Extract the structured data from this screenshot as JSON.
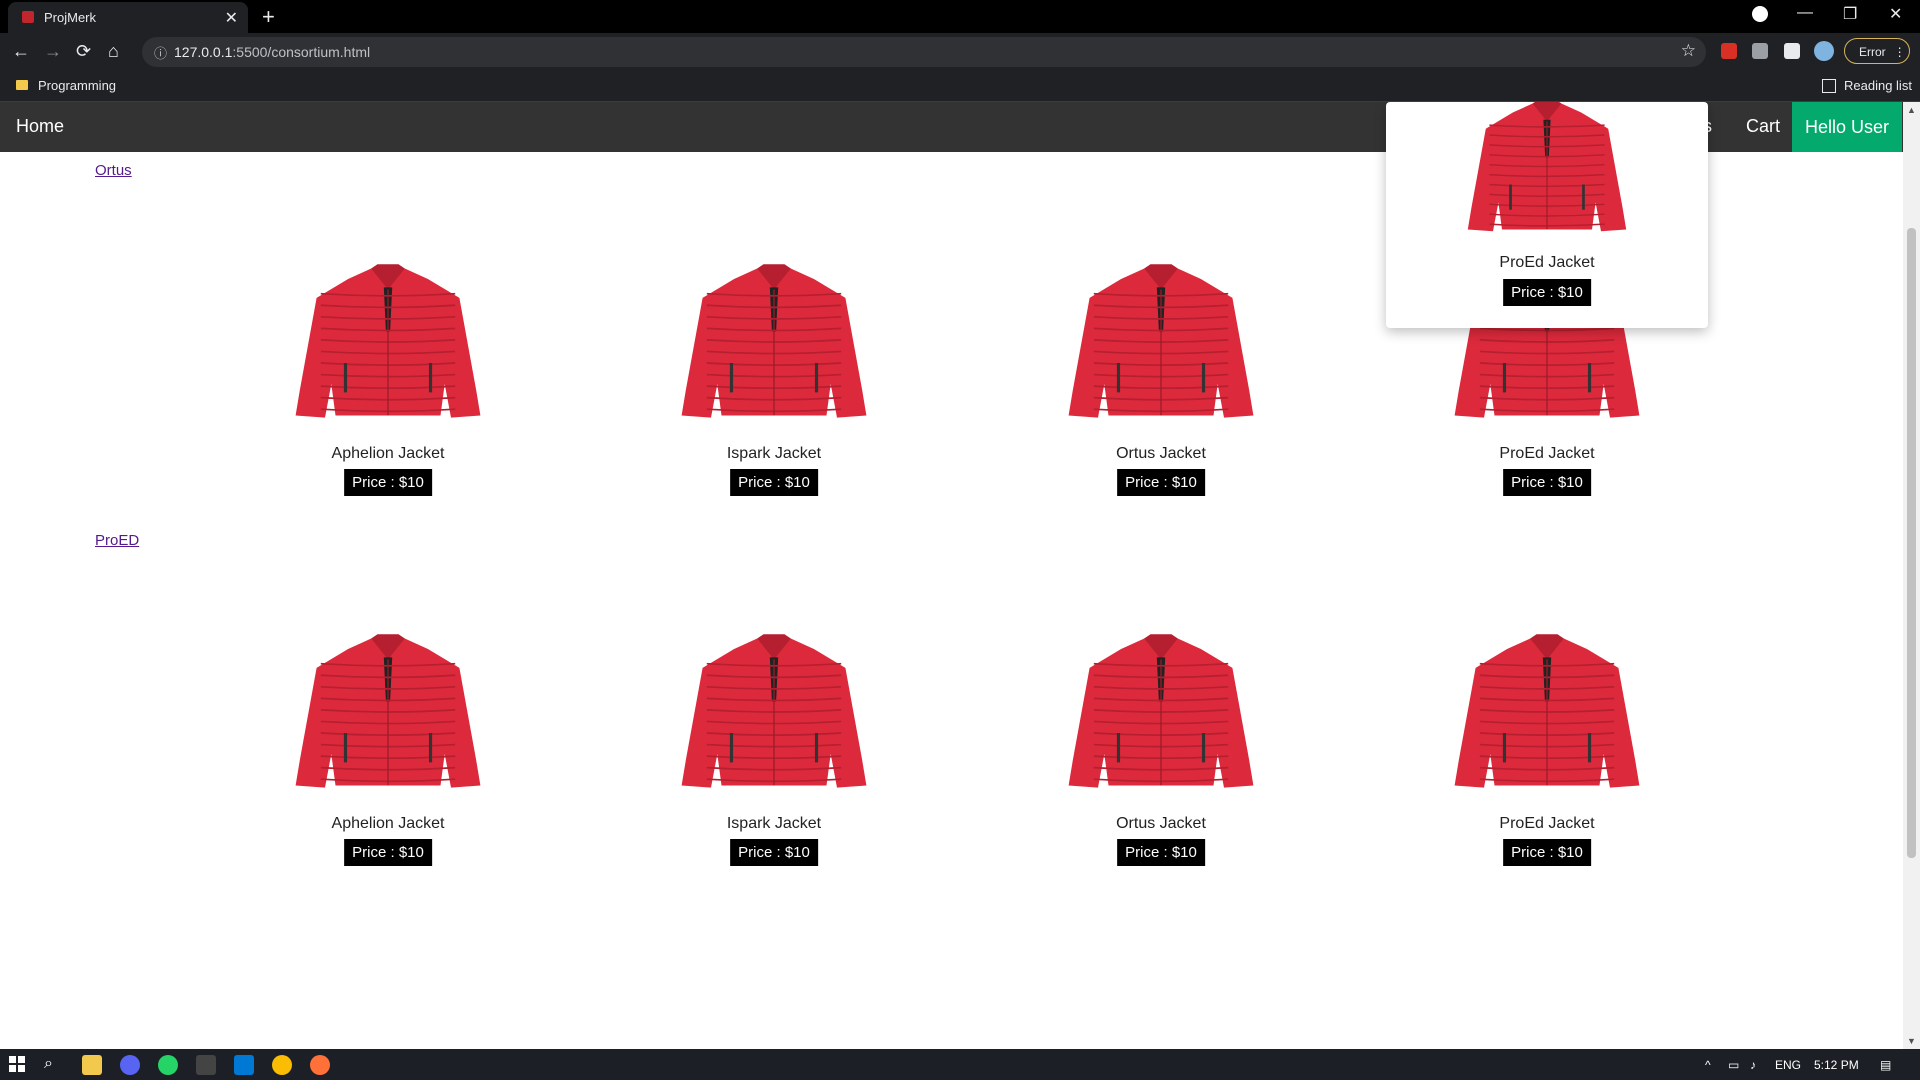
{
  "browser": {
    "tab_title": "ProjMerk",
    "tab_close": "✕",
    "new_tab": "+",
    "url_host": "127.0.0.1",
    "url_rest": ":5500/consortium.html",
    "bookmark": "Programming",
    "reading_list": "Reading list",
    "error_label": "Error",
    "back": "←",
    "forward": "→",
    "reload": "⟳",
    "home": "⌂",
    "star": "☆",
    "minimize": "—",
    "restore": "❐",
    "close": "✕"
  },
  "nav": {
    "home": "Home",
    "clubs_partial": "bs",
    "cart": "Cart",
    "hello": "Hello User"
  },
  "sections": [
    {
      "label": "",
      "products": [
        {
          "name": "Aphelion Jacket",
          "price": "Price : $10"
        },
        {
          "name": "Ispark Jacket",
          "price": "Price : $10"
        },
        {
          "name": "Ortus Jacket",
          "price": "Price : $10"
        },
        {
          "name": "ProEd Jacket",
          "price": "Price : $10"
        }
      ]
    },
    {
      "label": "Ortus",
      "products": [
        {
          "name": "Aphelion Jacket",
          "price": "Price : $10"
        },
        {
          "name": "Ispark Jacket",
          "price": "Price : $10"
        },
        {
          "name": "Ortus Jacket",
          "price": "Price : $10"
        },
        {
          "name": "ProEd Jacket",
          "price": "Price : $10"
        }
      ]
    },
    {
      "label": "ProED",
      "products": [
        {
          "name": "Aphelion Jacket",
          "price": "Price : $10"
        },
        {
          "name": "Ispark Jacket",
          "price": "Price : $10"
        },
        {
          "name": "Ortus Jacket",
          "price": "Price : $10"
        },
        {
          "name": "ProEd Jacket",
          "price": "Price : $10"
        }
      ]
    }
  ],
  "dropdown_card": {
    "name": "ProEd Jacket",
    "price": "Price : $10"
  },
  "taskbar": {
    "lang": "ENG",
    "time": "5:12 PM"
  },
  "colors": {
    "jacket": "#dc2a3c",
    "nav_bg": "#333333",
    "hello_bg": "#04aa6d"
  }
}
